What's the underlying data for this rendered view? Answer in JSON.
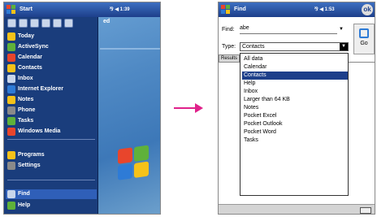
{
  "left": {
    "title": "Start",
    "status": "⅋ ◀ 1:39",
    "menu_items": [
      {
        "label": "Today",
        "icon": "today-icon",
        "color": "#f6c219"
      },
      {
        "label": "ActiveSync",
        "icon": "activesync-icon",
        "color": "#5fb13a"
      },
      {
        "label": "Calendar",
        "icon": "calendar-icon",
        "color": "#e8452c"
      },
      {
        "label": "Contacts",
        "icon": "contacts-icon",
        "color": "#f6c219"
      },
      {
        "label": "Inbox",
        "icon": "inbox-icon",
        "color": "#c9d6ea"
      },
      {
        "label": "Internet Explorer",
        "icon": "internet-explorer-icon",
        "color": "#2e7bd6"
      },
      {
        "label": "Notes",
        "icon": "notes-icon",
        "color": "#f6c219"
      },
      {
        "label": "Phone",
        "icon": "phone-icon",
        "color": "#8a8a8a"
      },
      {
        "label": "Tasks",
        "icon": "tasks-icon",
        "color": "#5fb13a"
      },
      {
        "label": "Windows Media",
        "icon": "windows-media-icon",
        "color": "#e8452c"
      }
    ],
    "bottom_items": [
      {
        "label": "Programs",
        "icon": "programs-icon",
        "color": "#f6c219"
      },
      {
        "label": "Settings",
        "icon": "settings-icon",
        "color": "#8a8a8a"
      }
    ],
    "find_label": "Find",
    "help_label": "Help",
    "desktop_text": "ed"
  },
  "right": {
    "title": "Find",
    "status": "⅋ ◀ 1:53",
    "ok": "ok",
    "find_label": "Find:",
    "find_value": "abe",
    "type_label": "Type:",
    "type_value": "Contacts",
    "go_label": "Go",
    "results_label": "Results",
    "type_options": [
      "All data",
      "Calendar",
      "Contacts",
      "Help",
      "Inbox",
      "Larger than 64 KB",
      "Notes",
      "Pocket Excel",
      "Pocket Outlook",
      "Pocket Word",
      "Tasks"
    ],
    "selected_option": "Contacts"
  },
  "colors": {
    "arrow": "#e0218a",
    "titlebar": "#1d3f8a"
  }
}
